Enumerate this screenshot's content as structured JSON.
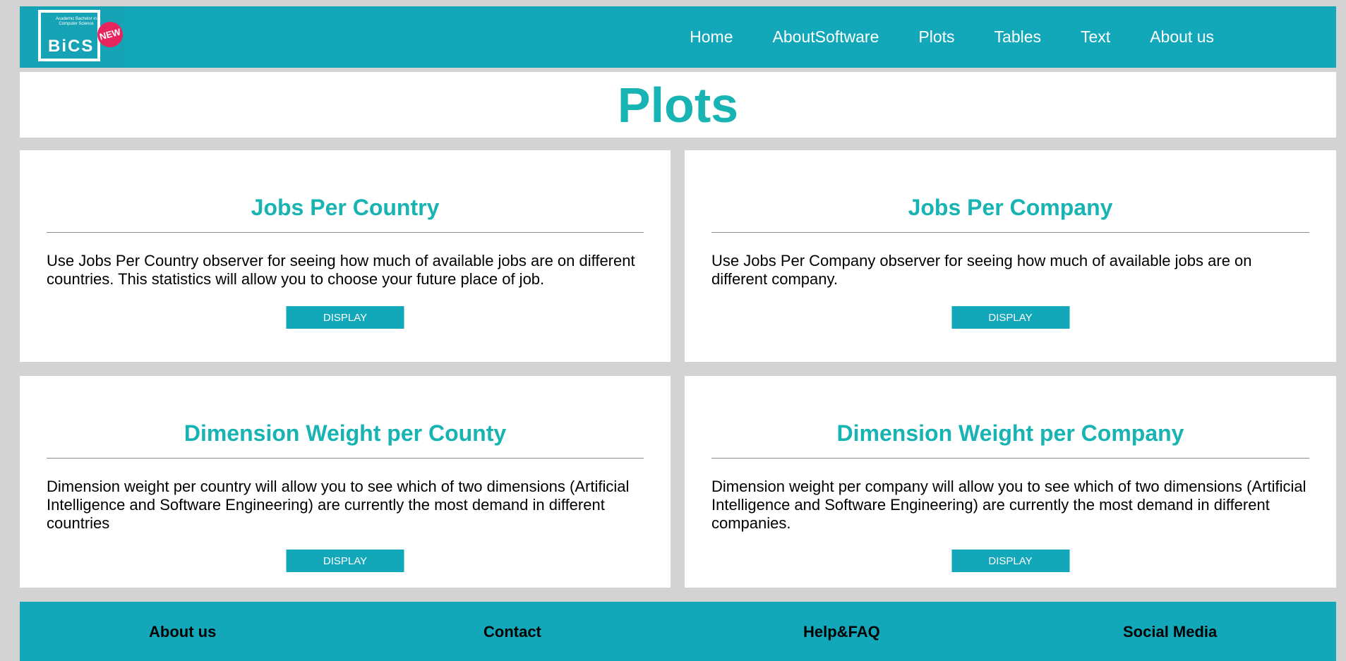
{
  "header": {
    "logo": {
      "small_text": "Academic Bachelor in Computer Science",
      "text": "BiCS",
      "badge": "NEW"
    },
    "nav": [
      "Home",
      "AboutSoftware",
      "Plots",
      "Tables",
      "Text",
      "About us"
    ]
  },
  "page": {
    "title": "Plots"
  },
  "cards": [
    {
      "title": "Jobs Per Country",
      "text": "Use Jobs Per Country observer for seeing how much of available jobs are on different countries. This statistics will allow you to choose your future place of job.",
      "button": "DISPLAY"
    },
    {
      "title": "Jobs Per Company",
      "text": "Use Jobs Per Company observer for seeing how much of available jobs are on different company.",
      "button": "DISPLAY"
    },
    {
      "title": "Dimension Weight per County",
      "text": "Dimension weight per country will allow you to see which of two dimensions (Artificial Intelligence and Software Engineering) are currently the most demand in different countries",
      "button": "DISPLAY"
    },
    {
      "title": "Dimension Weight per Company",
      "text": "Dimension weight per company will allow you to see which of two dimensions (Artificial Intelligence and Software Engineering) are currently the most demand in different companies.",
      "button": "DISPLAY"
    }
  ],
  "footer": [
    "About us",
    "Contact",
    "Help&FAQ",
    "Social Media"
  ],
  "colors": {
    "accent": "#12a8ba",
    "title": "#18b3b3",
    "background": "#d3d3d3",
    "badge": "#e8245f"
  }
}
